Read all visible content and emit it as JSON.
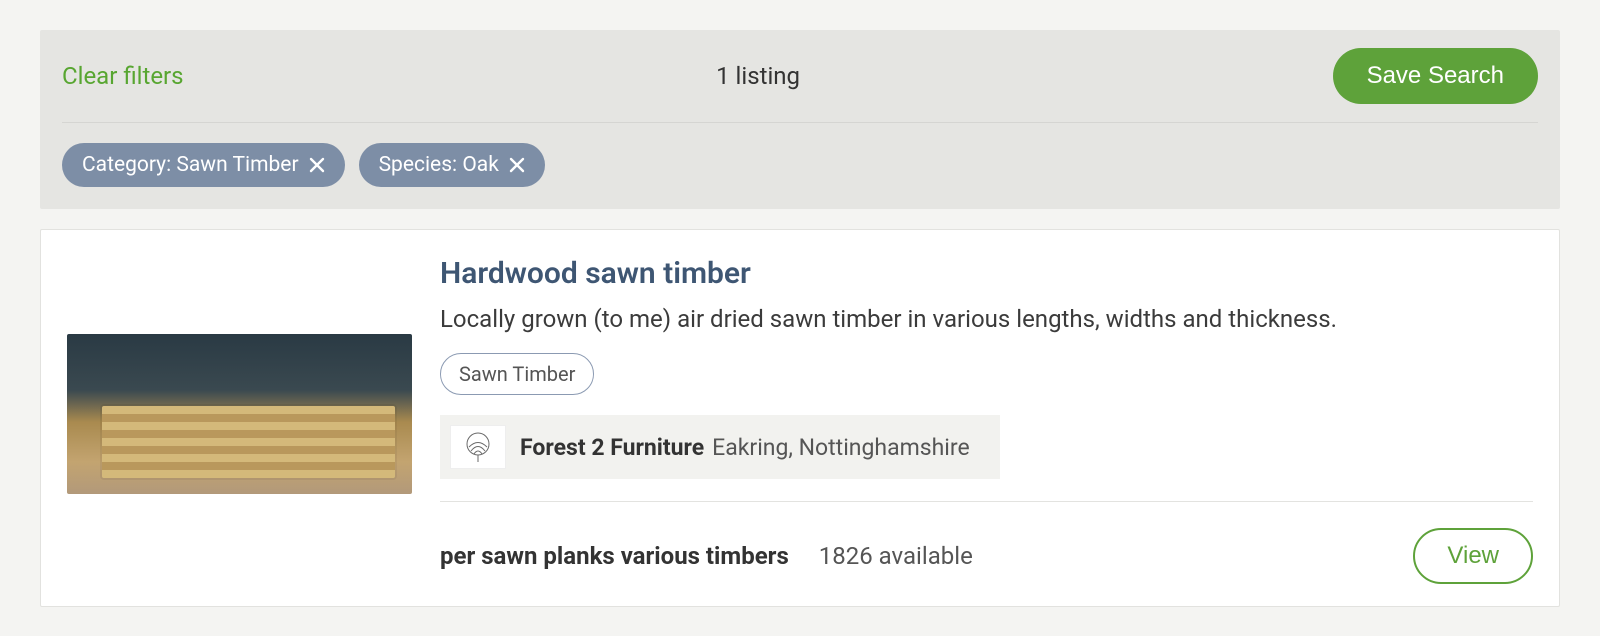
{
  "filters": {
    "clear_label": "Clear filters",
    "listing_count_text": "1 listing",
    "save_search_label": "Save Search",
    "chips": [
      {
        "label": "Category: Sawn Timber"
      },
      {
        "label": "Species: Oak"
      }
    ]
  },
  "listing": {
    "title": "Hardwood sawn timber",
    "description": "Locally grown (to me) air dried sawn timber in various lengths, widths and thickness.",
    "category_tag": "Sawn Timber",
    "seller": {
      "name": "Forest 2 Furniture",
      "location": "Eakring, Nottinghamshire"
    },
    "price_unit": "per sawn planks various timbers",
    "availability_text": "1826 available",
    "view_label": "View"
  },
  "icons": {
    "chip_remove": "close-icon",
    "seller_logo": "tree-icon"
  },
  "colors": {
    "accent_green": "#5ea23a",
    "chip_bg": "#7d8ea6",
    "title_blue": "#3e5673"
  }
}
